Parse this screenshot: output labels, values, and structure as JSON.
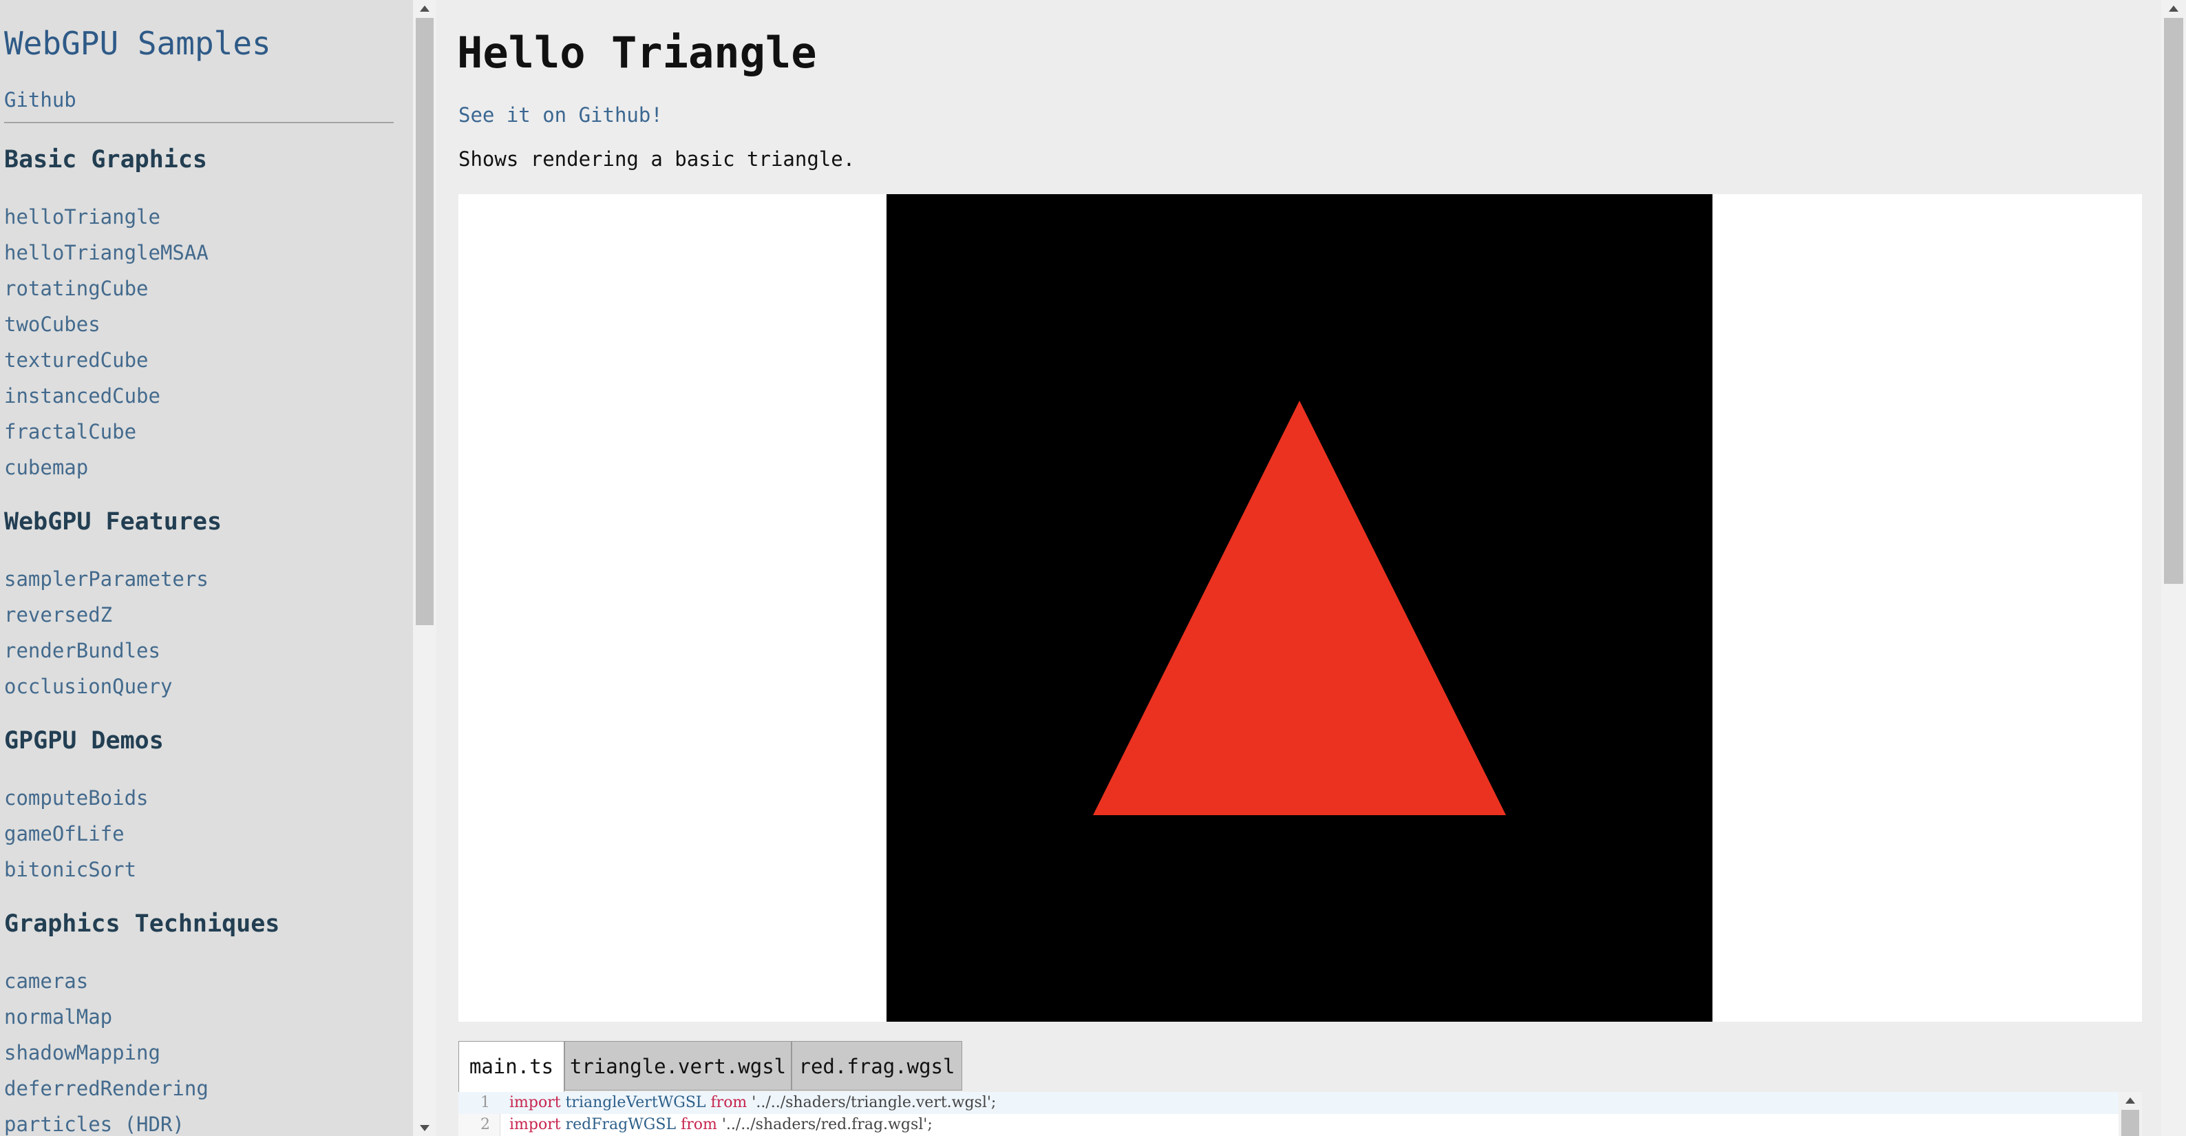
{
  "sidebar": {
    "title": "WebGPU Samples",
    "github": "Github",
    "sections": [
      {
        "heading": "Basic Graphics",
        "items": [
          "helloTriangle",
          "helloTriangleMSAA",
          "rotatingCube",
          "twoCubes",
          "texturedCube",
          "instancedCube",
          "fractalCube",
          "cubemap"
        ]
      },
      {
        "heading": "WebGPU Features",
        "items": [
          "samplerParameters",
          "reversedZ",
          "renderBundles",
          "occlusionQuery"
        ]
      },
      {
        "heading": "GPGPU Demos",
        "items": [
          "computeBoids",
          "gameOfLife",
          "bitonicSort"
        ]
      },
      {
        "heading": "Graphics Techniques",
        "items": [
          "cameras",
          "normalMap",
          "shadowMapping",
          "deferredRendering",
          "particles (HDR)"
        ]
      }
    ]
  },
  "main": {
    "title": "Hello Triangle",
    "github_link": "See it on Github!",
    "description": "Shows rendering a basic triangle.",
    "triangle_color": "#eb3220",
    "tabs": [
      "main.ts",
      "triangle.vert.wgsl",
      "red.frag.wgsl"
    ],
    "active_tab": "main.ts",
    "code": {
      "line_numbers": [
        "1",
        "2"
      ],
      "line1": {
        "kw1": "import",
        "ident": "triangleVertWGSL",
        "kw2": "from",
        "str": "'../../shaders/triangle.vert.wgsl';"
      },
      "line2": {
        "kw1": "import",
        "ident": "redFragWGSL",
        "kw2": "from",
        "str": "'../../shaders/red.frag.wgsl';"
      }
    }
  },
  "colors": {
    "accent": "#2e5a87",
    "link": "#436a8d",
    "heading": "#223e52"
  }
}
